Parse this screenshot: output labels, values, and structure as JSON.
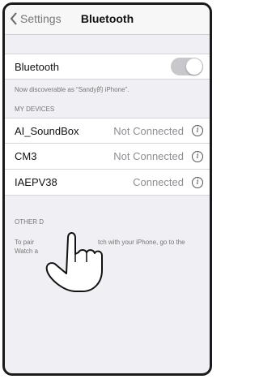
{
  "nav": {
    "back_label": "Settings",
    "title": "Bluetooth"
  },
  "bluetooth": {
    "label": "Bluetooth",
    "enabled": true,
    "discoverable_text": "Now discoverable as “Sandy的 iPhone”."
  },
  "my_devices": {
    "header": "MY DEVICES",
    "items": [
      {
        "name": "AI_SoundBox",
        "status": "Not Connected"
      },
      {
        "name": "CM3",
        "status": "Not Connected"
      },
      {
        "name": "IAEPV38",
        "status": "Connected"
      }
    ]
  },
  "other_devices": {
    "header": "OTHER D",
    "note_line1": "To pair",
    "note_line1b": "tch with your iPhone, go to the",
    "note_line2": "Watch a"
  },
  "icons": {
    "info": "i"
  }
}
